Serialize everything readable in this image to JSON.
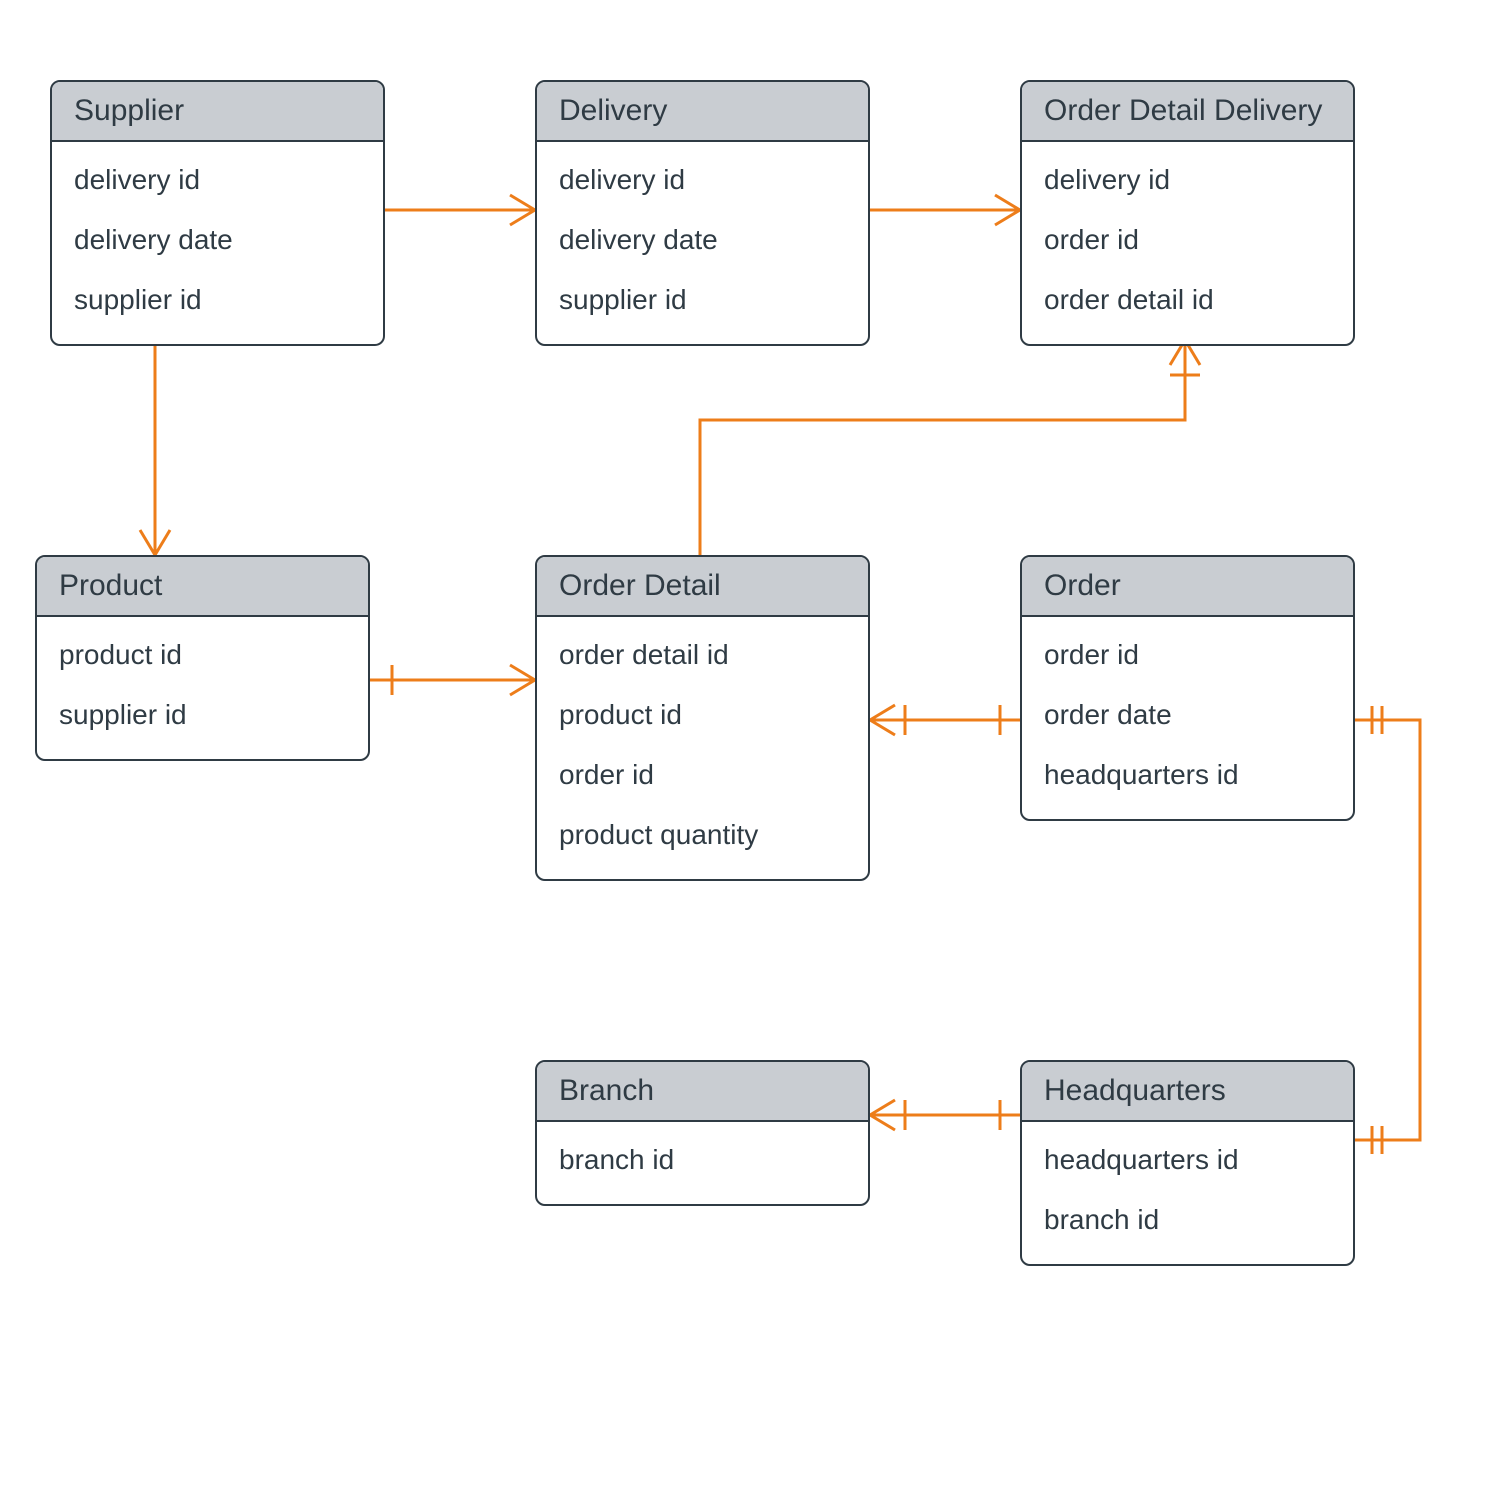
{
  "diagram": {
    "type": "entity-relationship",
    "colors": {
      "line": "#ed7d1a",
      "box_border": "#2f3b44",
      "title_bg": "#c9cdd2"
    }
  },
  "entities": {
    "supplier": {
      "title": "Supplier",
      "attrs": [
        "delivery id",
        "delivery date",
        "supplier id"
      ]
    },
    "delivery": {
      "title": "Delivery",
      "attrs": [
        "delivery id",
        "delivery date",
        "supplier id"
      ]
    },
    "order_detail_delivery": {
      "title": "Order Detail Delivery",
      "attrs": [
        "delivery id",
        "order id",
        "order detail id"
      ]
    },
    "product": {
      "title": "Product",
      "attrs": [
        "product id",
        "supplier id"
      ]
    },
    "order_detail": {
      "title": "Order Detail",
      "attrs": [
        "order detail id",
        "product id",
        "order id",
        "product quantity"
      ]
    },
    "order": {
      "title": "Order",
      "attrs": [
        "order id",
        "order date",
        "headquarters id"
      ]
    },
    "branch": {
      "title": "Branch",
      "attrs": [
        "branch id"
      ]
    },
    "headquarters": {
      "title": "Headquarters",
      "attrs": [
        "headquarters id",
        "branch id"
      ]
    }
  },
  "relationships": [
    {
      "from": "supplier",
      "to": "delivery",
      "from_card": "one",
      "to_card": "many"
    },
    {
      "from": "delivery",
      "to": "order_detail_delivery",
      "from_card": "one",
      "to_card": "many"
    },
    {
      "from": "supplier",
      "to": "product",
      "from_card": "one",
      "to_card": "many"
    },
    {
      "from": "product",
      "to": "order_detail",
      "from_card": "one_mandatory",
      "to_card": "many"
    },
    {
      "from": "order_detail",
      "to": "order_detail_delivery",
      "from_card": "one",
      "to_card": "many_mandatory"
    },
    {
      "from": "order",
      "to": "order_detail",
      "from_card": "one_mandatory",
      "to_card": "many_mandatory"
    },
    {
      "from": "headquarters",
      "to": "order",
      "from_card": "one_mandatory",
      "to_card": "one_mandatory"
    },
    {
      "from": "headquarters",
      "to": "branch",
      "from_card": "one_mandatory",
      "to_card": "many_mandatory"
    }
  ]
}
